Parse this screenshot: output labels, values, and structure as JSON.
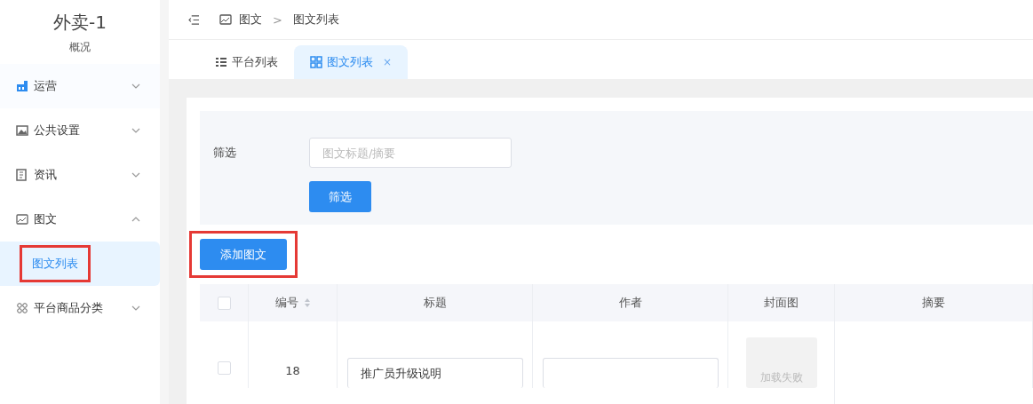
{
  "sidebar": {
    "title": "外卖-1",
    "subtitle": "概况",
    "items": [
      {
        "label": "运营",
        "expanded": false
      },
      {
        "label": "公共设置",
        "expanded": false
      },
      {
        "label": "资讯",
        "expanded": false
      },
      {
        "label": "图文",
        "expanded": true,
        "children": [
          {
            "label": "图文列表",
            "selected": true,
            "highlighted": true
          }
        ]
      },
      {
        "label": "平台商品分类",
        "expanded": false
      }
    ]
  },
  "breadcrumb": {
    "items": [
      "图文",
      "图文列表"
    ],
    "separator": ">"
  },
  "tabs": [
    {
      "label": "平台列表",
      "selected": false
    },
    {
      "label": "图文列表",
      "selected": true,
      "close": "×"
    }
  ],
  "filter": {
    "label": "筛选",
    "placeholder": "图文标题/摘要",
    "button": "筛选"
  },
  "add_button": {
    "label": "添加图文",
    "highlighted": true
  },
  "table": {
    "all_checked": false,
    "columns": [
      "编号",
      "标题",
      "作者",
      "封面图",
      "摘要"
    ],
    "rows": [
      {
        "checked": false,
        "id": "18",
        "title": "推广员升级说明",
        "author": "",
        "cover": "加载失败"
      }
    ]
  }
}
